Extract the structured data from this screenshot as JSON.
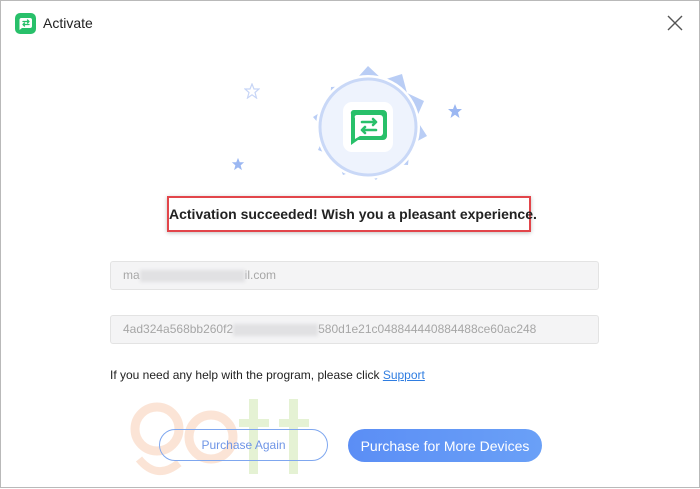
{
  "window": {
    "title": "Activate",
    "close_icon": "close-icon"
  },
  "badge": {
    "icon": "app-logo-exchange-icon",
    "accent_color": "#28c06a",
    "ring_color": "#a9c2f6"
  },
  "message": {
    "success_text": "Activation succeeded! Wish you a pleasant experience.",
    "highlight_color": "#e2454a"
  },
  "fields": {
    "email_visible_prefix": "ma",
    "email_visible_suffix": "il.com",
    "key_visible_prefix": "4ad324a568bb260f2",
    "key_visible_suffix": "580d1e21c048844440884488ce60ac248"
  },
  "help": {
    "text": "If you need any help with the program, please click ",
    "link_label": "Support"
  },
  "buttons": {
    "purchase_again": "Purchase Again",
    "purchase_more": "Purchase for More Devices"
  },
  "colors": {
    "primary": "#5b8ef5",
    "link": "#2f7de1"
  }
}
